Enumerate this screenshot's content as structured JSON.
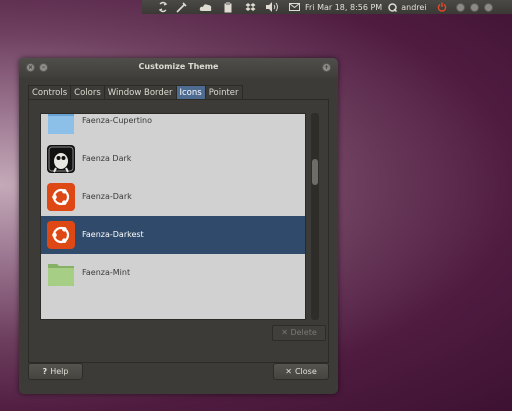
{
  "panel": {
    "datetime": "Fri Mar 18,  8:56 PM",
    "user": "andrei",
    "icons": [
      "ubuntuone-sync-icon",
      "pen-tool-icon",
      "cloud-icon",
      "clipboard-icon",
      "dropbox-icon",
      "volume-icon",
      "mail-icon",
      "messaging-icon",
      "power-icon",
      "window-minimize-icon",
      "window-restore-icon",
      "window-close-icon"
    ]
  },
  "window": {
    "title": "Customize Theme",
    "tabs": [
      {
        "label": "Controls",
        "active": false
      },
      {
        "label": "Colors",
        "active": false
      },
      {
        "label": "Window Border",
        "active": false
      },
      {
        "label": "Icons",
        "active": true
      },
      {
        "label": "Pointer",
        "active": false
      }
    ],
    "themes": [
      {
        "label": "Faenza-Cupertino",
        "icon": "blue-folder-icon",
        "selected": false
      },
      {
        "label": "Faenza Dark",
        "icon": "gimp-icon",
        "selected": false
      },
      {
        "label": "Faenza-Dark",
        "icon": "ubuntu-logo-icon",
        "selected": false
      },
      {
        "label": "Faenza-Darkest",
        "icon": "ubuntu-logo-icon",
        "selected": true
      },
      {
        "label": "Faenza-Mint",
        "icon": "green-folder-icon",
        "selected": false
      }
    ],
    "delete_label": "Delete",
    "help_label": "Help",
    "close_label": "Close"
  },
  "colors": {
    "selection": "#2f4a6a",
    "active_tab": "#4e6c92",
    "ubuntu_orange": "#dd4814",
    "folder_blue": "#8cc0e8",
    "folder_green": "#a6ce84"
  }
}
